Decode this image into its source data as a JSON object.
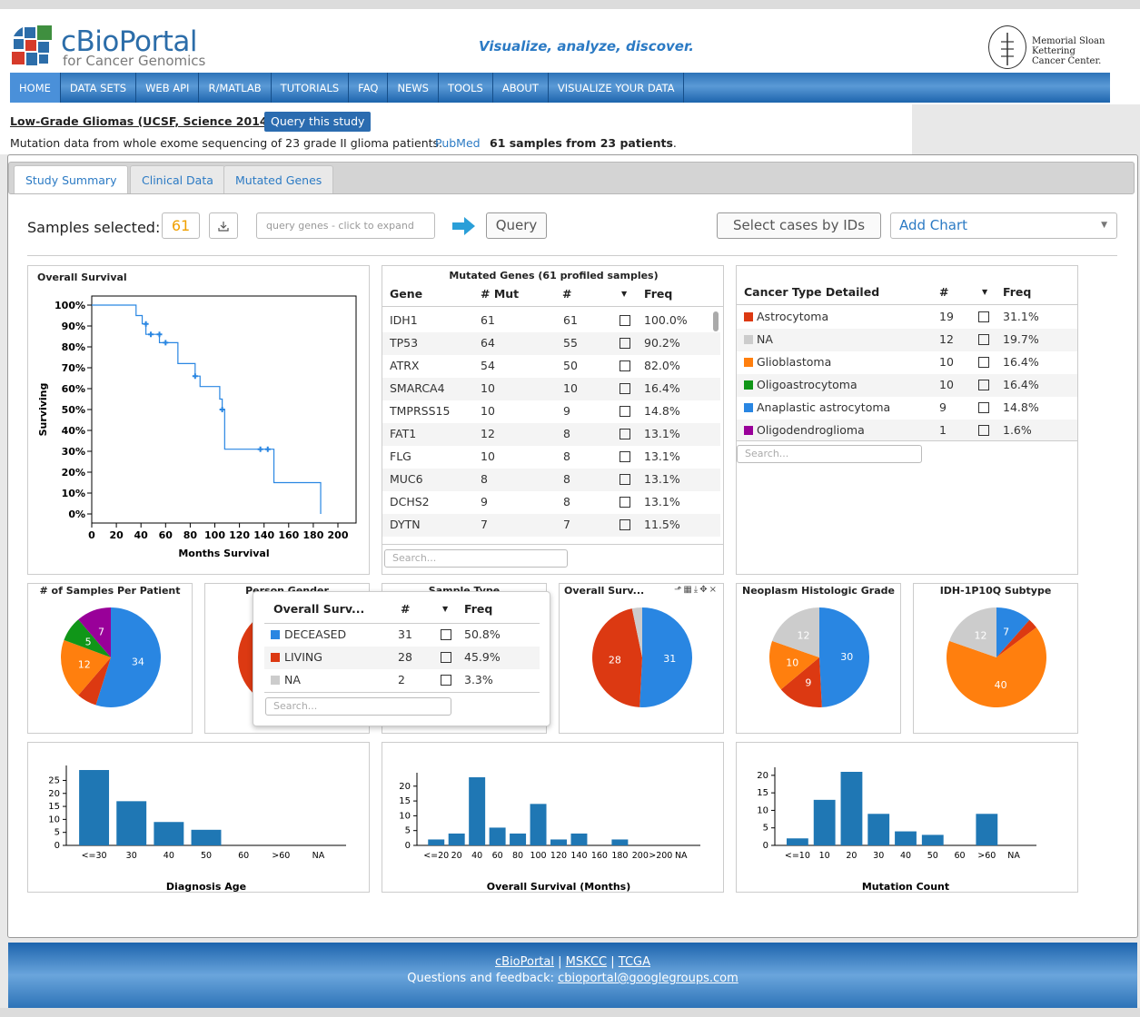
{
  "logo": {
    "title": "cBioPortal",
    "subtitle": "for Cancer Genomics",
    "tagline": "Visualize, analyze, discover.",
    "partner_line1": "Memorial Sloan Kettering",
    "partner_line2": "Cancer Center."
  },
  "nav": [
    "HOME",
    "DATA SETS",
    "WEB API",
    "R/MATLAB",
    "TUTORIALS",
    "FAQ",
    "NEWS",
    "TOOLS",
    "ABOUT",
    "VISUALIZE YOUR DATA"
  ],
  "study": {
    "title": "Low-Grade Gliomas (UCSF, Science 2014)",
    "query_button": "Query this study",
    "description": "Mutation data from whole exome sequencing of 23 grade II glioma patients.",
    "pubmed": "PubMed",
    "samples_text": "61 samples from 23 patients",
    "samples_suffix": "."
  },
  "tabs": [
    "Study Summary",
    "Clinical Data",
    "Mutated Genes"
  ],
  "toolbar": {
    "samples_label": "Samples selected:",
    "samples_count": "61",
    "gene_placeholder": "query genes - click to expand",
    "query_label": "Query",
    "select_cases_label": "Select cases by IDs",
    "add_chart_label": "Add Chart"
  },
  "survival": {
    "title": "Overall Survival",
    "ylabel": "Surviving",
    "xlabel": "Months Survival",
    "yticks": [
      "100%",
      "90%",
      "80%",
      "70%",
      "60%",
      "50%",
      "40%",
      "30%",
      "20%",
      "10%",
      "0%"
    ],
    "xticks": [
      "0",
      "20",
      "40",
      "60",
      "80",
      "100",
      "120",
      "140",
      "160",
      "180",
      "200"
    ]
  },
  "mutated_genes": {
    "title": "Mutated Genes (61 profiled samples)",
    "headers": [
      "Gene",
      "# Mut",
      "#",
      "",
      "Freq"
    ],
    "rows": [
      [
        "IDH1",
        "61",
        "61",
        "100.0%"
      ],
      [
        "TP53",
        "64",
        "55",
        "90.2%"
      ],
      [
        "ATRX",
        "54",
        "50",
        "82.0%"
      ],
      [
        "SMARCA4",
        "10",
        "10",
        "16.4%"
      ],
      [
        "TMPRSS15",
        "10",
        "9",
        "14.8%"
      ],
      [
        "FAT1",
        "12",
        "8",
        "13.1%"
      ],
      [
        "FLG",
        "10",
        "8",
        "13.1%"
      ],
      [
        "MUC6",
        "8",
        "8",
        "13.1%"
      ],
      [
        "DCHS2",
        "9",
        "8",
        "13.1%"
      ],
      [
        "DYTN",
        "7",
        "7",
        "11.5%"
      ]
    ],
    "search_placeholder": "Search..."
  },
  "cancer_type": {
    "headers": [
      "Cancer Type Detailed",
      "#",
      "",
      "Freq"
    ],
    "rows": [
      [
        "Astrocytoma",
        "19",
        "31.1%",
        "#dc3912"
      ],
      [
        "NA",
        "12",
        "19.7%",
        "#cccccc"
      ],
      [
        "Glioblastoma",
        "10",
        "16.4%",
        "#ff7f0e"
      ],
      [
        "Oligoastrocytoma",
        "10",
        "16.4%",
        "#109618"
      ],
      [
        "Anaplastic astrocytoma",
        "9",
        "14.8%",
        "#2986e2"
      ],
      [
        "Oligodendroglioma",
        "1",
        "1.6%",
        "#990099"
      ]
    ],
    "search_placeholder": "Search..."
  },
  "pies": {
    "samples_per_patient": {
      "title": "# of Samples Per Patient",
      "labels": [
        "34",
        "12",
        "5",
        "7"
      ]
    },
    "gender": {
      "title": "Person Gender"
    },
    "sample_type": {
      "title": "Sample Type"
    },
    "overall_survival": {
      "title": "Overall Surv...",
      "labels": [
        "31",
        "28"
      ]
    },
    "neoplasm": {
      "title": "Neoplasm Histologic Grade",
      "labels": [
        "30",
        "9",
        "10",
        "12"
      ]
    },
    "idh": {
      "title": "IDH-1P10Q Subtype",
      "labels": [
        "7",
        "40",
        "12"
      ]
    }
  },
  "popup": {
    "headers": [
      "Overall Surv...",
      "#",
      "",
      "Freq"
    ],
    "rows": [
      [
        "DECEASED",
        "31",
        "50.8%",
        "#2986e2"
      ],
      [
        "LIVING",
        "28",
        "45.9%",
        "#dc3912"
      ],
      [
        "NA",
        "2",
        "3.3%",
        "#cccccc"
      ]
    ],
    "search_placeholder": "Search..."
  },
  "bar_charts": [
    {
      "title": "Diagnosis Age",
      "categories": [
        "<=30",
        "30",
        "40",
        "50",
        "60",
        ">60",
        "NA"
      ],
      "yticks": [
        "25",
        "20",
        "15",
        "10",
        "5",
        "0"
      ]
    },
    {
      "title": "Overall Survival (Months)",
      "categories": [
        "<=20",
        "20",
        "40",
        "60",
        "80",
        "100",
        "120",
        "140",
        "160",
        "180",
        "200",
        ">200",
        "NA"
      ],
      "yticks": [
        "20",
        "15",
        "10",
        "5",
        "0"
      ]
    },
    {
      "title": "Mutation Count",
      "categories": [
        "<=10",
        "10",
        "20",
        "30",
        "40",
        "50",
        "60",
        ">60",
        "NA"
      ],
      "yticks": [
        "20",
        "15",
        "10",
        "5",
        "0"
      ]
    }
  ],
  "chart_data": [
    {
      "type": "line",
      "title": "Overall Survival",
      "xlabel": "Months Survival",
      "ylabel": "Surviving",
      "xlim": [
        0,
        200
      ],
      "ylim": [
        0,
        100
      ],
      "x": [
        0,
        36,
        41,
        44,
        48,
        55,
        60,
        70,
        84,
        88,
        104,
        106,
        108,
        146,
        148,
        186
      ],
      "y": [
        100,
        95,
        91,
        86,
        86,
        82,
        82,
        72,
        66,
        61,
        55,
        50,
        31,
        31,
        15,
        0
      ]
    },
    {
      "type": "pie",
      "title": "# of Samples Per Patient",
      "values": [
        34,
        4,
        12,
        5,
        7
      ]
    },
    {
      "type": "pie",
      "title": "Overall Surv...",
      "categories": [
        "DECEASED",
        "LIVING",
        "NA"
      ],
      "values": [
        31,
        28,
        2
      ]
    },
    {
      "type": "pie",
      "title": "Neoplasm Histologic Grade",
      "values": [
        30,
        9,
        10,
        12
      ]
    },
    {
      "type": "pie",
      "title": "IDH-1P10Q Subtype",
      "values": [
        7,
        2,
        40,
        12
      ]
    },
    {
      "type": "bar",
      "title": "Diagnosis Age",
      "categories": [
        "<=30",
        "30",
        "40",
        "50",
        "60",
        ">60",
        "NA"
      ],
      "values": [
        29,
        17,
        9,
        6,
        0,
        0,
        0
      ],
      "ylim": [
        0,
        29
      ]
    },
    {
      "type": "bar",
      "title": "Overall Survival (Months)",
      "categories": [
        "<=20",
        "20",
        "40",
        "60",
        "80",
        "100",
        "120",
        "140",
        "160",
        "180",
        "200",
        ">200",
        "NA"
      ],
      "values": [
        2,
        4,
        23,
        6,
        4,
        14,
        2,
        4,
        0,
        2,
        0,
        0,
        0
      ],
      "ylim": [
        0,
        23
      ]
    },
    {
      "type": "bar",
      "title": "Mutation Count",
      "categories": [
        "<=10",
        "10",
        "20",
        "30",
        "40",
        "50",
        "60",
        ">60",
        "NA"
      ],
      "values": [
        2,
        13,
        21,
        9,
        4,
        3,
        0,
        9,
        0
      ],
      "ylim": [
        0,
        21
      ]
    }
  ],
  "footer": {
    "link1": "cBioPortal",
    "link2": "MSKCC",
    "link3": "TCGA",
    "sep": "|",
    "feedback": "Questions and feedback:",
    "email": "cbioportal@googlegroups.com"
  }
}
